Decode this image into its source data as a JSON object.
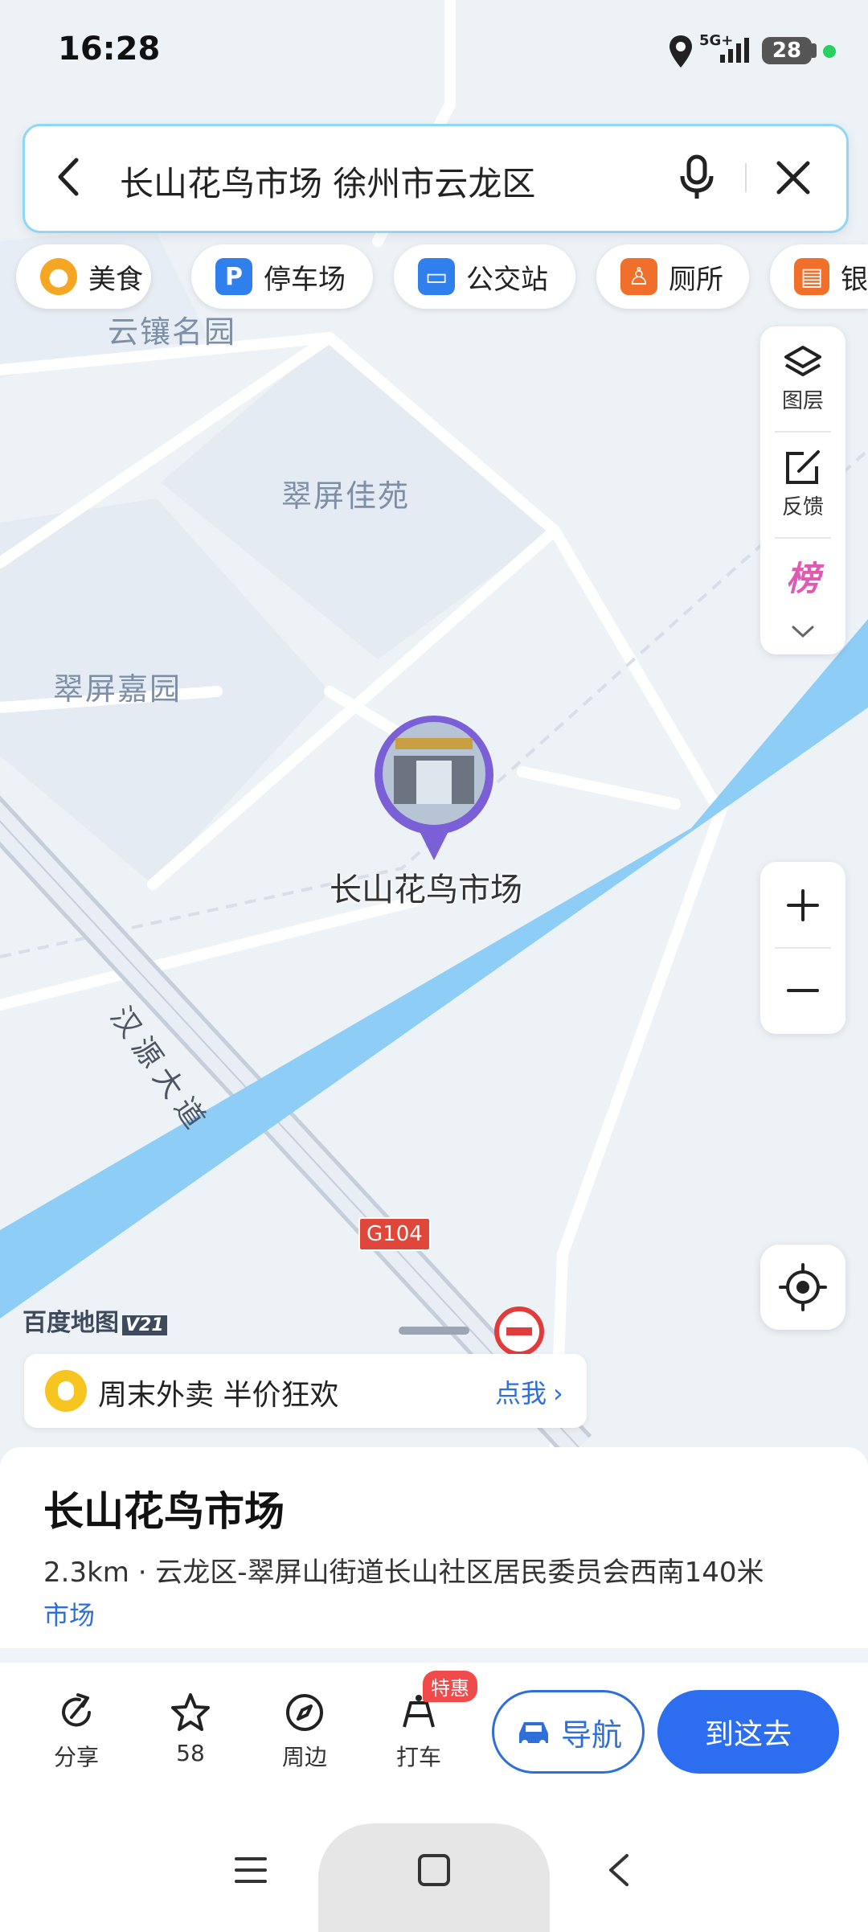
{
  "status_bar": {
    "time": "16:28",
    "network": "5G+",
    "battery": "28"
  },
  "search": {
    "query": "长山花鸟市场 徐州市云龙区"
  },
  "categories": [
    {
      "label": "美食",
      "icon": "food-icon",
      "color": "#f5a623"
    },
    {
      "label": "停车场",
      "icon": "parking-icon",
      "color": "#2f80ed"
    },
    {
      "label": "公交站",
      "icon": "bus-stop-icon",
      "color": "#2f80ed"
    },
    {
      "label": "厕所",
      "icon": "toilet-icon",
      "color": "#f0702b"
    },
    {
      "label": "银",
      "icon": "bank-icon",
      "color": "#f0702b"
    }
  ],
  "map": {
    "areas": [
      "云镶名园",
      "翠屏佳苑",
      "翠屏嘉园"
    ],
    "road_name": "汉源大道",
    "highway_badge": "G104",
    "marker_label": "长山花鸟市场",
    "logo": "百度地图",
    "logo_version": "V21"
  },
  "tools": {
    "layers": "图层",
    "feedback": "反馈",
    "ranking": "榜"
  },
  "promo": {
    "text": "周末外卖 半价狂欢",
    "link": "点我"
  },
  "poi": {
    "title": "长山花鸟市场",
    "address": "2.3km · 云龙区-翠屏山街道长山社区居民委员会西南140米",
    "category": "市场"
  },
  "actions": {
    "share": "分享",
    "favorite_count": "58",
    "nearby": "周边",
    "taxi": "打车",
    "taxi_badge": "特惠",
    "navigate": "导航",
    "go_here": "到这去"
  },
  "colors": {
    "accent": "#2d6ef0",
    "river": "#8ecdf6",
    "map_bg": "#edf2f7"
  }
}
